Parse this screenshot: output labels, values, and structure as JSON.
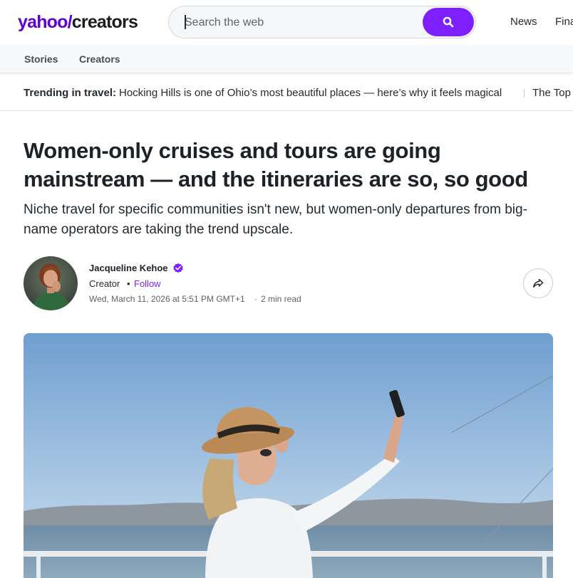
{
  "header": {
    "logo_yahoo": "yahoo/",
    "logo_creators": "creators",
    "search_placeholder": "Search the web",
    "links": [
      "News",
      "Fina"
    ]
  },
  "subnav": {
    "items": [
      "Stories",
      "Creators"
    ]
  },
  "trending": {
    "label": "Trending in travel:",
    "items": [
      "Hocking Hills is one of Ohio’s most beautiful places — here’s why it feels magical",
      "The Top"
    ]
  },
  "article": {
    "title": "Women-only cruises and tours are going mainstream — and the itineraries are so, so good",
    "subtitle": "Niche travel for specific communities isn't new, but women-only departures from big-name operators are taking the trend upscale.",
    "author": {
      "name": "Jacqueline Kehoe",
      "role": "Creator",
      "follow_label": "Follow",
      "date": "Wed, March 11, 2026 at 5:51 PM GMT+1",
      "read_time": "2 min read"
    }
  },
  "colors": {
    "brand_purple": "#7e1fff",
    "logo_purple": "#6001d2"
  },
  "icons": [
    "search-icon",
    "verified-badge-icon",
    "share-icon"
  ]
}
